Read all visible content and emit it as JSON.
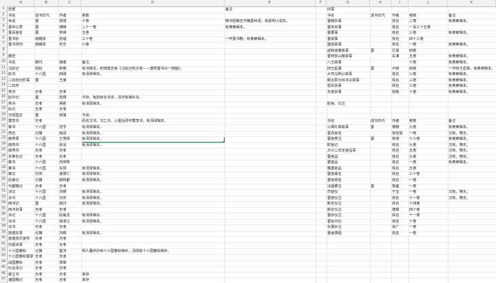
{
  "columns": [
    "A",
    "B",
    "C",
    "D",
    "E",
    "F",
    "G",
    "H",
    "I",
    "J",
    "K"
  ],
  "accent": "#217346",
  "left_rows": [
    [
      "史部",
      "",
      "",
      ""
    ],
    [
      "书名",
      "成书年代",
      "作者",
      "卷数"
    ],
    [
      "世说",
      "晋",
      "郭颁",
      "十卷"
    ],
    [
      "晋世公赞",
      "晋",
      "傅畅",
      "二十一卷"
    ],
    [
      "晋百官名",
      "晋",
      "苟绰",
      "五卷"
    ],
    [
      "晋书钞",
      "南朝梁",
      "张缅",
      "三十卷"
    ],
    [
      "晋书鸿列",
      "南朝梁",
      "张氏",
      "六卷"
    ],
    [
      "",
      "",
      "",
      ""
    ],
    [
      "霸史",
      "",
      "",
      ""
    ],
    [
      "书名",
      "朝代",
      "撰者",
      "备注"
    ],
    [
      "汉赵记",
      "前赵",
      "和苞",
      "有书辑本。町田隆吉有《汉赵记佚文考——唐修晋书の一侧面》。"
    ],
    [
      "赵书",
      "十六国",
      "田融",
      "有汤球辑本。"
    ],
    [
      "二石伪治时事",
      "晋",
      "王度",
      ""
    ],
    [
      "二石传",
      "",
      "",
      ""
    ],
    [
      "燕书",
      "无考",
      "无考",
      ""
    ],
    [
      "赵中记",
      "晋",
      "陆翙",
      "今存，有四库全书本，清代有辑补本。"
    ],
    [
      "燕书",
      "无考",
      "吴胜",
      "有汤球辑本。"
    ],
    [
      "赵记",
      "无考",
      "无考",
      ""
    ],
    [
      "华阳国志",
      "晋",
      "常璩",
      "今存。"
    ],
    [
      "蜀李书",
      "无考",
      "",
      "原名汉书，汉之书，入晋后改作蜀李书，有汤球辑本。"
    ],
    [
      "秦书",
      "十六国",
      "范亨",
      "有汤球辑本。"
    ],
    [
      "燕志",
      "北魏",
      "高闾",
      "有汤球辑本。"
    ],
    [
      "南燕录",
      "十六国",
      "王景晖",
      "有汤球辑本。"
    ],
    [
      "南燕书",
      "十六国",
      "张诠",
      "有汤球辑本。"
    ],
    [
      "南燕书",
      "无考",
      "无考",
      ""
    ],
    [
      "甘蔗杂记",
      "无考",
      "无考",
      ""
    ],
    [
      "秦书",
      "十六国",
      "何仲熙",
      ""
    ],
    [
      "秦书",
      "十六国",
      "车频",
      "有汤球辑本。"
    ],
    [
      "秦记",
      "刘宋",
      "裴景仁",
      "有汤球辑本。"
    ],
    [
      "后秦记",
      "北魏",
      "姚和都",
      "有汤球辑本。"
    ],
    [
      "代都略记",
      "无考",
      "无考",
      ""
    ],
    [
      "凉记",
      "十六国",
      "刘昞",
      "有汤球辑本。"
    ],
    [
      "凉书",
      "十六国",
      "刘庆",
      "有汤球辑本。"
    ],
    [
      "西河记",
      "晋",
      "喻归",
      "有汤球辑本。"
    ],
    [
      "西河旧事",
      "无考",
      "无考",
      ""
    ],
    [
      "凉记",
      "十六国",
      "段龟龙",
      "有汤球辑本。"
    ],
    [
      "凉书",
      "十六国",
      "高道让",
      "有汤球辑本。"
    ],
    [
      "凉书",
      "无考",
      "无考",
      ""
    ],
    [
      "敦煌实录",
      "北魏",
      "刘昞",
      "有汤球辑本。"
    ],
    [
      "敦煌张氏家传",
      "无考",
      "无考",
      ""
    ],
    [
      "托跋凉录",
      "无考",
      "无考",
      ""
    ],
    [
      "十六国春秋",
      "北魏",
      "崔鸿",
      "明人屠乔孙有十六国春秋辑补，汤球有十六国春秋辑补。"
    ],
    [
      "十六国春秋纂录",
      "无考",
      "无考",
      ""
    ],
    [
      "战国春秋",
      "无考",
      "李槩",
      ""
    ],
    [
      "吐谷浑记",
      "无考",
      "无考",
      ""
    ],
    [
      "翟辽书",
      "无考",
      "无考",
      "单存"
    ],
    [
      "诸国略记",
      "无考",
      "无考",
      "单存"
    ]
  ],
  "left_e": {
    "0": "备注",
    "2": "隋书经籍志作魏晋世语，有孤明小说本。",
    "3": "有黄奭辑本。",
    "5": "一作晋书略，有黄奭辑本。"
  },
  "right_rows": [
    [
      "旧事",
      "",
      "",
      "",
      ""
    ],
    [
      "书名",
      "成书年代",
      "作者",
      "卷数",
      "备注"
    ],
    [
      "晋朝杂事",
      "",
      "佚名",
      "二卷",
      "有黄奭辑本。"
    ],
    [
      "晋宋旧事",
      "",
      "佚名",
      "一百三十五卷",
      ""
    ],
    [
      "晋要事",
      "",
      "佚名",
      "三卷",
      "有黄奭辑本。"
    ],
    [
      "晋故事",
      "",
      "佚名",
      "四十三卷",
      ""
    ],
    [
      "建武故事",
      "",
      "佚名",
      "一卷",
      "有黄奭辑本。"
    ],
    [
      "咸和咸康故事",
      "晋",
      "孔愉",
      "四卷",
      ""
    ],
    [
      "晋修复山陵故事",
      "",
      "车灌",
      "五卷",
      "有黄奭辑本。"
    ],
    [
      "八王故事",
      "",
      "",
      "十卷",
      "有黄奭辑本。"
    ],
    [
      "四王起事",
      "晋",
      "卢綝",
      "四卷",
      "一作四王遗事，有黄奭辑本。"
    ],
    [
      "大司马陶公故事",
      "",
      "佚名",
      "三卷",
      "有黄奭辑本。"
    ],
    [
      "郗太尉为尚书令故事",
      "",
      "佚名",
      "三卷",
      "有黄奭辑本。"
    ],
    [
      "桓玄伪事",
      "",
      "佚名",
      "三卷",
      "有黄奭辑本。"
    ],
    [
      "东宫旧事",
      "",
      "张敞",
      "十卷",
      "有黄奭辑本。"
    ],
    [
      "",
      "",
      "",
      "",
      ""
    ],
    [
      "职官、仪注",
      "",
      "",
      "",
      ""
    ],
    [
      "",
      "",
      "",
      "",
      ""
    ],
    [
      "",
      "",
      "",
      "",
      ""
    ],
    [
      "书名",
      "成书年代",
      "作者",
      "卷数",
      "备注"
    ],
    [
      "公卿礼秩故事",
      "晋",
      "傅畅",
      "九卷",
      "有黄奭辑本。"
    ],
    [
      "晋百官名",
      "",
      "徐宣瑜",
      "一卷",
      "汉有，隋无。"
    ],
    [
      "晋官表注",
      "晋",
      "苟绰",
      "十六卷",
      "有黄奭辑本。"
    ],
    [
      "职官记",
      "",
      "佚名",
      "九卷",
      "汉有，隋无。"
    ],
    [
      "大兴二年定官品事",
      "",
      "佚名",
      "五卷",
      "汉有，隋无。"
    ],
    [
      "晋官品",
      "",
      "佚名",
      "九卷",
      "汉有，隋无。"
    ],
    [
      "晋官品",
      "",
      "佚名",
      "一卷",
      "有黄奭辑本。"
    ],
    [
      "魏晋官品",
      "",
      "佚名",
      "五卷",
      ""
    ],
    [
      "晋官属名",
      "",
      "佚名",
      "三十卷",
      ""
    ],
    [
      "晋宫阙名",
      "",
      "佚名",
      "一卷",
      ""
    ],
    [
      "决疑要注",
      "晋",
      "挚虞",
      "一卷",
      ""
    ],
    [
      "司徒仪",
      "",
      "于宝",
      "一卷",
      "汉有，隋无。"
    ],
    [
      "晋官仪注",
      "",
      "佚名",
      "十一卷",
      "汉有，隋无。"
    ],
    [
      "新定仪注",
      "",
      "佚名",
      "十四卷",
      ""
    ],
    [
      "新定仪注",
      "",
      "傅瑗",
      "四十卷",
      ""
    ],
    [
      "晋杂仪注",
      "",
      "佚名",
      "十一卷",
      ""
    ],
    [
      "晋尚书仪",
      "",
      "佚名",
      "十卷",
      ""
    ],
    [
      "车服杂注",
      "",
      "徐广",
      "一卷",
      ""
    ],
    [
      "晋卤簿图",
      "",
      "佚名",
      "一卷",
      ""
    ]
  ]
}
